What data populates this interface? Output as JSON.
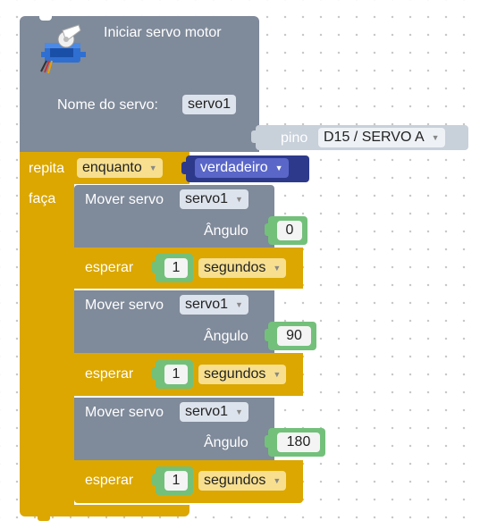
{
  "init_block": {
    "title": "Iniciar servo motor",
    "name_label": "Nome do servo:",
    "name_value": "servo1",
    "pin_label": "pino",
    "pin_value": "D15 / SERVO A"
  },
  "loop_block": {
    "repeat_label": "repita",
    "mode_value": "enquanto",
    "condition_value": "verdadeiro",
    "do_label": "faça"
  },
  "steps": [
    {
      "move_label": "Mover servo",
      "servo_value": "servo1",
      "angle_label": "Ângulo",
      "angle_value": "0",
      "wait_label": "esperar",
      "wait_value": "1",
      "unit_value": "segundos"
    },
    {
      "move_label": "Mover servo",
      "servo_value": "servo1",
      "angle_label": "Ângulo",
      "angle_value": "90",
      "wait_label": "esperar",
      "wait_value": "1",
      "unit_value": "segundos"
    },
    {
      "move_label": "Mover servo",
      "servo_value": "servo1",
      "angle_label": "Ângulo",
      "angle_value": "180",
      "wait_label": "esperar",
      "wait_value": "1",
      "unit_value": "segundos"
    }
  ],
  "colors": {
    "servo_block": "#7f8a9a",
    "loop_block": "#dba700",
    "logic_block": "#2d3a8c",
    "number_block": "#73c07b",
    "pin_block": "#c8d0da"
  }
}
